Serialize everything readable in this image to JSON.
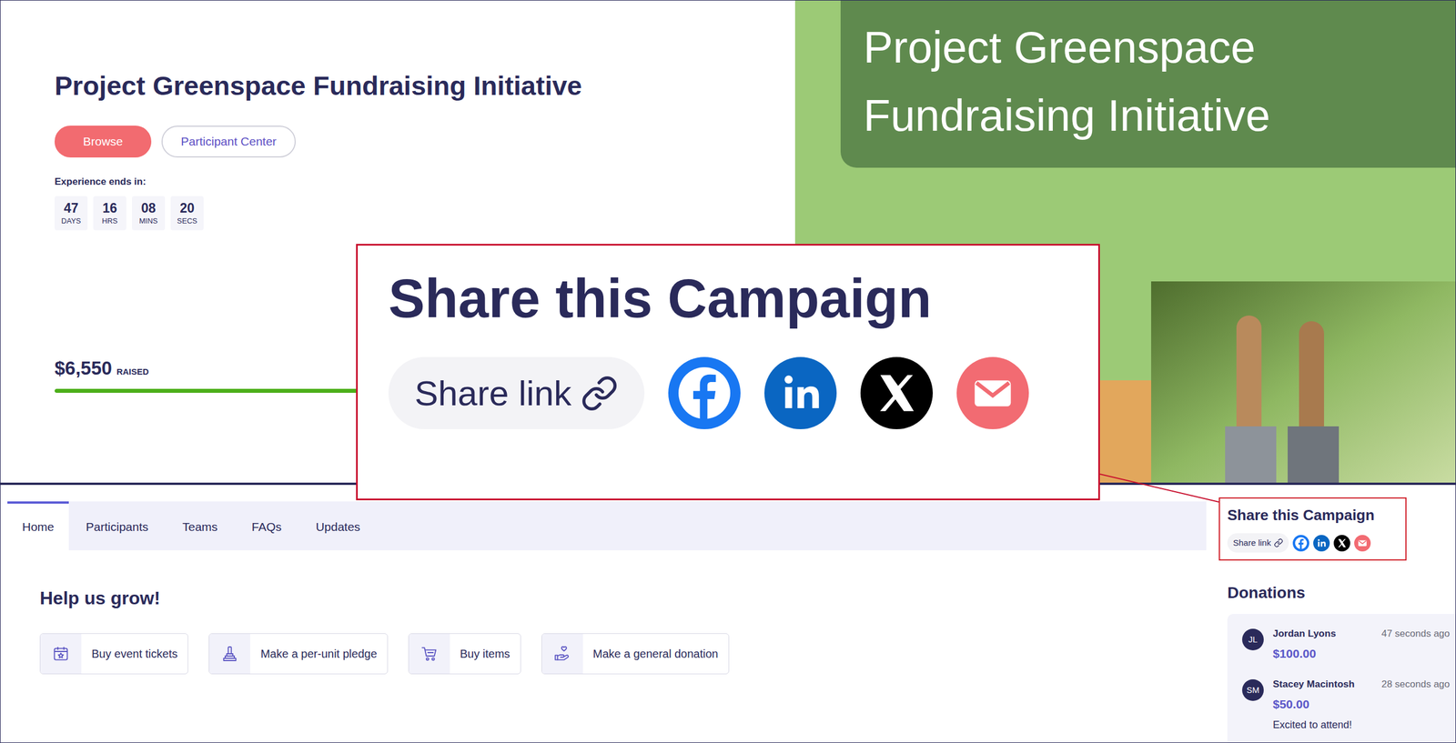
{
  "campaign": {
    "title": "Project Greenspace Fundraising Initiative",
    "buttons": [
      {
        "label": "Browse",
        "kind": "filled"
      },
      {
        "label": "Participant Center",
        "kind": "outline"
      }
    ]
  },
  "countdown": {
    "label": "Experience ends in:",
    "units": [
      {
        "value": "47",
        "unit": "DAYS"
      },
      {
        "value": "16",
        "unit": "HRS"
      },
      {
        "value": "08",
        "unit": "MINS"
      },
      {
        "value": "20",
        "unit": "SECS"
      }
    ]
  },
  "progress": {
    "amount": "$6,550",
    "label": "RAISED",
    "level": 0.6
  },
  "banner": {
    "lines": [
      "Project Greenspace",
      "Fundraising Initiative"
    ]
  },
  "tabs": [
    {
      "label": "Home",
      "selected": true
    },
    {
      "label": "Participants",
      "selected": false
    },
    {
      "label": "Teams",
      "selected": false
    },
    {
      "label": "FAQs",
      "selected": false
    },
    {
      "label": "Updates",
      "selected": false
    }
  ],
  "help": {
    "title": "Help us grow!",
    "actions": [
      {
        "label": "Buy event tickets"
      },
      {
        "label": "Make a per-unit pledge"
      },
      {
        "label": "Buy items"
      },
      {
        "label": "Make a general donation"
      }
    ]
  },
  "share": {
    "title": "Share this Campaign",
    "link": "Share link"
  },
  "callout": {
    "title": "Share this Campaign",
    "link": "Share link"
  },
  "donations": {
    "title": "Donations",
    "items": [
      {
        "initials": "JL",
        "name": "Jordan Lyons",
        "time": "47 seconds ago",
        "amount": "$100.00"
      },
      {
        "initials": "SM",
        "name": "Stacey Macintosh",
        "time": "28 seconds ago",
        "amount": "$50.00",
        "message": "Excited to attend!"
      }
    ]
  }
}
